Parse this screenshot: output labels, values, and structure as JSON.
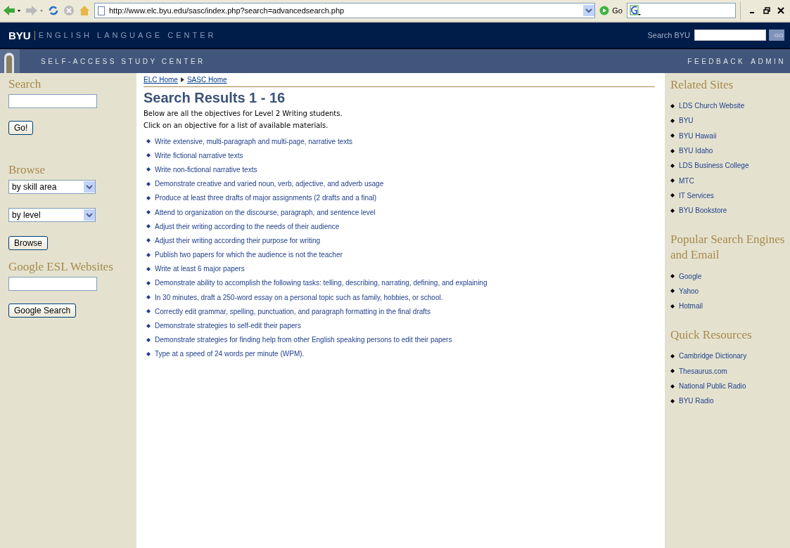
{
  "browser": {
    "address": "http://www.elc.byu.edu/sasc/index.php?search=advancedsearch.php",
    "go_label": "Go"
  },
  "header": {
    "brand": "BYU",
    "title": "ENGLISH LANGUAGE CENTER",
    "search_label": "Search BYU",
    "search_button": "GO"
  },
  "subheader": {
    "title": "SELF-ACCESS STUDY CENTER",
    "links": [
      "FEEDBACK",
      "ADMIN"
    ]
  },
  "left_sidebar": {
    "search": {
      "heading": "Search",
      "button": "Go!"
    },
    "browse": {
      "heading": "Browse",
      "selects": [
        "by skill area",
        "by level"
      ],
      "button": "Browse"
    },
    "google": {
      "heading": "Google ESL Websites",
      "button": "Google Search"
    }
  },
  "breadcrumb": [
    "ELC Home",
    "SASC Home"
  ],
  "results": {
    "title": "Search Results 1 - 16",
    "intro": [
      "Below are all the objectives for Level 2 Writing students.",
      "Click on an objective for a list of available materials."
    ],
    "items": [
      "Write extensive, multi-paragraph and multi-page, narrative texts",
      "Write fictional narrative texts",
      "Write non-fictional narrative texts",
      "Demonstrate creative and varied noun, verb, adjective, and adverb usage",
      "Produce at least three drafts of major assignments (2 drafts and a final)",
      "Attend to organization on the discourse, paragraph, and sentence level",
      "Adjust their writing according to the needs of their audience",
      "Adjust their writing according their purpose for writing",
      "Publish two papers for which the audience is not the teacher",
      "Write at least 6 major papers",
      "Demonstrate ability to accomplish the following tasks: telling, describing, narrating, defining, and explaining",
      "In 30 minutes, draft a 250-word essay on a personal topic such as family, hobbies, or school.",
      "Correctly edit grammar, spelling, punctuation, and paragraph formatting in the final drafts",
      "Demonstrate strategies to self-edit their papers",
      "Demonstrate strategies for finding help from other English speaking persons to edit their papers",
      "Type at a speed of 24 words per minute (WPM)."
    ]
  },
  "right_sidebar": [
    {
      "heading": "Related Sites",
      "links": [
        "LDS Church Website",
        "BYU",
        "BYU Hawaii",
        "BYU Idaho",
        "LDS Business College",
        "MTC",
        "IT Services",
        "BYU Bookstore"
      ]
    },
    {
      "heading": "Popular Search Engines and Email",
      "links": [
        "Google",
        "Yahoo",
        "Hotmail"
      ]
    },
    {
      "heading": "Quick Resources",
      "links": [
        "Cambridge Dictionary",
        "Thesaurus.com",
        "National Public Radio",
        "BYU Radio"
      ]
    }
  ]
}
